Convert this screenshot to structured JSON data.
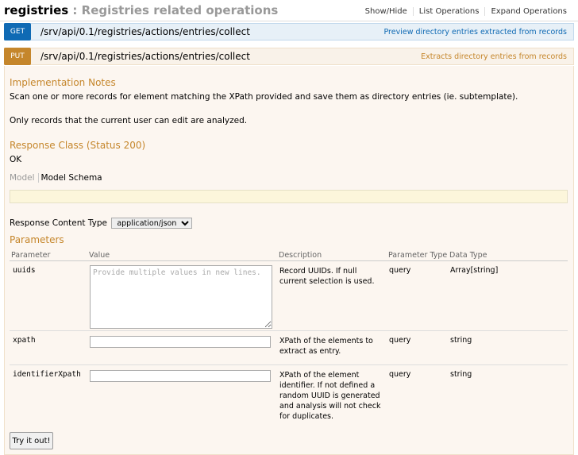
{
  "header": {
    "resource": "registries",
    "description": " : Registries related operations",
    "links": [
      "Show/Hide",
      "List Operations",
      "Expand Operations"
    ]
  },
  "operations": [
    {
      "method": "GET",
      "path": "/srv/api/0.1/registries/actions/entries/collect",
      "summary": "Preview directory entries extracted from records"
    },
    {
      "method": "PUT",
      "path": "/srv/api/0.1/registries/actions/entries/collect",
      "summary": "Extracts directory entries from records"
    }
  ],
  "details": {
    "impl_heading": "Implementation Notes",
    "impl_text_1": "Scan one or more records for element matching the XPath provided and save them as directory entries (ie. subtemplate).",
    "impl_text_2": "Only records that the current user can edit are analyzed.",
    "response_heading": "Response Class (Status 200)",
    "response_value": "OK",
    "tab_model": "Model",
    "tab_schema": "Model Schema",
    "rct_label": "Response Content Type",
    "rct_value": "application/json",
    "params_heading": "Parameters",
    "columns": [
      "Parameter",
      "Value",
      "Description",
      "Parameter Type",
      "Data Type"
    ],
    "params": [
      {
        "name": "uuids",
        "placeholder": "Provide multiple values in new lines.",
        "description": "Record UUIDs. If null current selection is used.",
        "param_type": "query",
        "data_type": "Array[string]"
      },
      {
        "name": "xpath",
        "placeholder": "",
        "description": "XPath of the elements to extract as entry.",
        "param_type": "query",
        "data_type": "string"
      },
      {
        "name": "identifierXpath",
        "placeholder": "",
        "description": "XPath of the element identifier. If not defined a random UUID is generated and analysis will not check for duplicates.",
        "param_type": "query",
        "data_type": "string"
      }
    ],
    "try_button": "Try it out!"
  }
}
